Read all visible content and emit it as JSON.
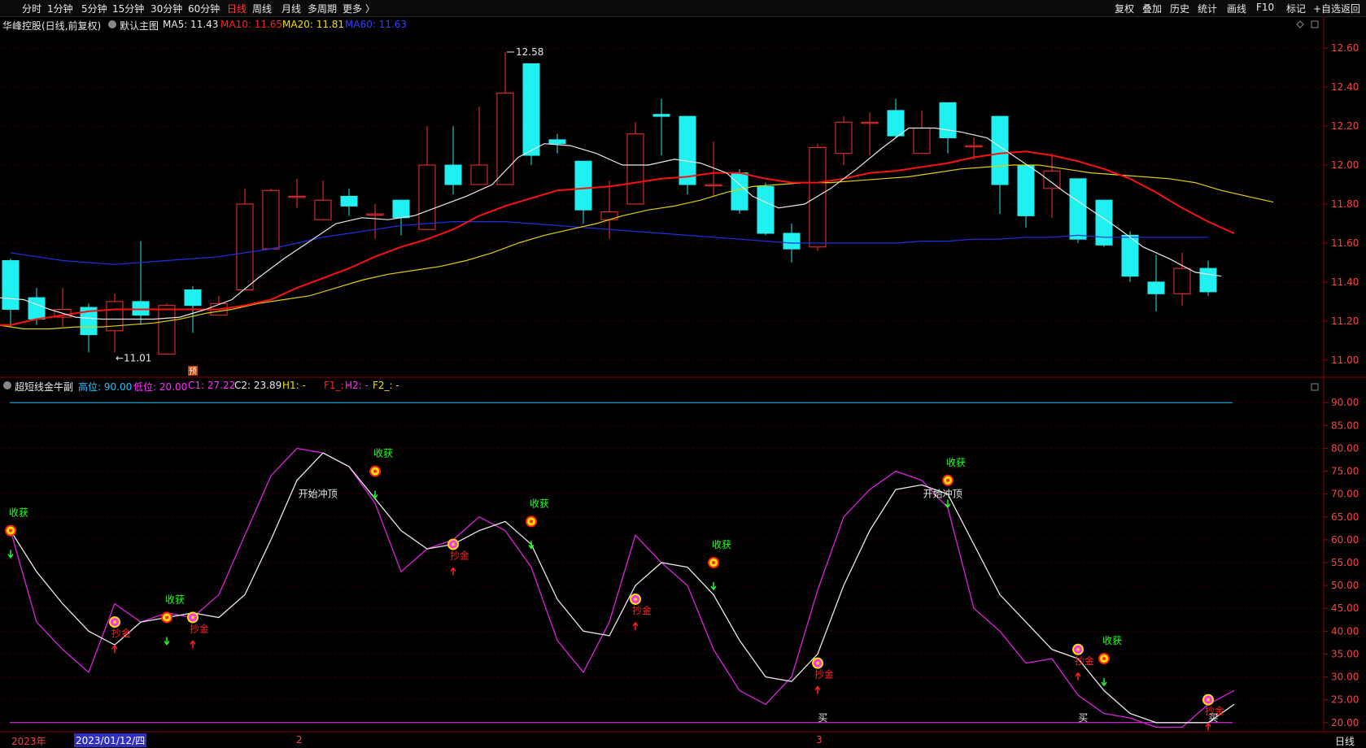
{
  "toolbar": {
    "left_items": [
      "分时",
      "1分钟",
      "5分钟",
      "15分钟",
      "30分钟",
      "60分钟",
      "日线",
      "周线",
      "月线",
      "多周期",
      "更多 〉"
    ],
    "active_item": "日线",
    "right_items": [
      "复权",
      "叠加",
      "历史",
      "统计",
      "画线",
      "F10",
      "标记",
      "+自选",
      "返回"
    ]
  },
  "main_chart": {
    "title": "华峰控股(日线,前复权)",
    "template": "默认主图",
    "ma": [
      {
        "label": "MA5: 11.43",
        "color": "#e8e8e8"
      },
      {
        "label": "MA10: 11.65",
        "color": "#ff2020"
      },
      {
        "label": "MA20: 11.81",
        "color": "#f0e000"
      },
      {
        "label": "MA60: 11.63",
        "color": "#3040ff"
      }
    ],
    "high_label": "12.58",
    "low_label": "←11.01",
    "pre_marker": "预"
  },
  "sub_chart": {
    "title": "超短线金牛副",
    "params": [
      {
        "label": "高位: 90.00",
        "color": "#20c0ff"
      },
      {
        "label": "低位: 20.00",
        "color": "#ff30ff"
      },
      {
        "label": "C1: 27.22",
        "color": "#ff30ff"
      },
      {
        "label": "C2: 23.89",
        "color": "#e8e8e8"
      },
      {
        "label": "H1: -",
        "color": "#f0e000"
      },
      {
        "label": "F1_: -",
        "color": "#ff2020"
      },
      {
        "label": "H2: -",
        "color": "#ff30ff"
      },
      {
        "label": "F2_: -",
        "color": "#f0e000"
      }
    ]
  },
  "axes": {
    "price_ticks": [
      "12.60",
      "12.40",
      "12.20",
      "12.00",
      "11.80",
      "11.60",
      "11.40",
      "11.20",
      "11.00"
    ],
    "osc_ticks": [
      "90.00",
      "85.00",
      "80.00",
      "75.00",
      "70.00",
      "65.00",
      "60.00",
      "55.00",
      "50.00",
      "45.00",
      "40.00",
      "35.00",
      "30.00",
      "25.00",
      "20.00"
    ]
  },
  "bottom_bar": {
    "year_label": "2023年",
    "date_cursor": "2023/01/12/四",
    "month_2": "2",
    "month_3": "3",
    "period": "日线"
  },
  "chart_data": {
    "type": "candlestick",
    "price_range": [
      10.92,
      12.68
    ],
    "candles": [
      [
        11.51,
        11.26,
        11.52,
        11.17
      ],
      [
        11.32,
        11.21,
        11.37,
        11.18
      ],
      [
        11.22,
        11.26,
        11.37,
        11.17
      ],
      [
        11.27,
        11.13,
        11.29,
        11.04
      ],
      [
        11.15,
        11.3,
        11.34,
        11.04
      ],
      [
        11.3,
        11.23,
        11.61,
        11.18
      ],
      [
        11.03,
        11.28,
        11.29,
        11.03
      ],
      [
        11.36,
        11.28,
        11.38,
        11.14
      ],
      [
        11.23,
        11.29,
        11.33,
        11.23
      ],
      [
        11.36,
        11.8,
        11.88,
        11.36
      ],
      [
        11.57,
        11.87,
        11.88,
        11.57
      ],
      [
        11.84,
        11.84,
        11.93,
        11.78
      ],
      [
        11.72,
        11.82,
        11.92,
        11.72
      ],
      [
        11.84,
        11.79,
        11.88,
        11.74
      ],
      [
        11.75,
        11.75,
        11.8,
        11.62
      ],
      [
        11.82,
        11.73,
        11.82,
        11.64
      ],
      [
        11.67,
        12.0,
        12.2,
        11.67
      ],
      [
        12.0,
        11.9,
        12.2,
        11.85
      ],
      [
        11.9,
        12.0,
        12.3,
        11.9
      ],
      [
        11.9,
        12.37,
        12.58,
        11.9
      ],
      [
        12.52,
        12.05,
        12.52,
        12.0
      ],
      [
        12.13,
        12.11,
        12.16,
        12.06
      ],
      [
        12.02,
        11.77,
        12.02,
        11.7
      ],
      [
        11.72,
        11.76,
        11.92,
        11.62
      ],
      [
        11.8,
        12.16,
        12.22,
        11.8
      ],
      [
        12.26,
        12.25,
        12.34,
        12.05
      ],
      [
        12.25,
        11.9,
        12.25,
        11.85
      ],
      [
        11.9,
        11.9,
        12.12,
        11.84
      ],
      [
        11.96,
        11.77,
        11.98,
        11.75
      ],
      [
        11.89,
        11.65,
        11.91,
        11.64
      ],
      [
        11.65,
        11.57,
        11.7,
        11.5
      ],
      [
        11.58,
        12.09,
        12.11,
        11.56
      ],
      [
        12.06,
        12.22,
        12.25,
        12.0
      ],
      [
        12.22,
        12.22,
        12.27,
        12.05
      ],
      [
        12.28,
        12.15,
        12.34,
        12.14
      ],
      [
        12.06,
        12.19,
        12.28,
        12.06
      ],
      [
        12.32,
        12.14,
        12.32,
        12.06
      ],
      [
        12.1,
        12.1,
        12.14,
        12.03
      ],
      [
        12.25,
        11.9,
        12.25,
        11.75
      ],
      [
        12.0,
        11.74,
        12.0,
        11.68
      ],
      [
        11.88,
        11.97,
        12.06,
        11.73
      ],
      [
        11.93,
        11.62,
        11.93,
        11.6
      ],
      [
        11.82,
        11.59,
        11.82,
        11.58
      ],
      [
        11.64,
        11.43,
        11.66,
        11.4
      ],
      [
        11.4,
        11.34,
        11.54,
        11.25
      ],
      [
        11.34,
        11.47,
        11.55,
        11.28
      ],
      [
        11.47,
        11.35,
        11.51,
        11.33
      ]
    ],
    "ma5": [
      11.32,
      11.31,
      11.26,
      11.22,
      11.21,
      11.21,
      11.21,
      11.22,
      11.26,
      11.31,
      11.42,
      11.52,
      11.61,
      11.7,
      11.73,
      11.72,
      11.74,
      11.79,
      11.84,
      11.9,
      12.04,
      12.11,
      12.1,
      12.06,
      12.0,
      12.0,
      12.03,
      12.01,
      11.96,
      11.84,
      11.78,
      11.8,
      11.88,
      11.98,
      12.09,
      12.19,
      12.19,
      12.17,
      12.14,
      12.05,
      11.96,
      11.86,
      11.77,
      11.68,
      11.58,
      11.52,
      11.45,
      11.43
    ],
    "ma10": [
      11.18,
      11.18,
      11.21,
      11.23,
      11.25,
      11.26,
      11.26,
      11.26,
      11.26,
      11.26,
      11.28,
      11.31,
      11.37,
      11.42,
      11.47,
      11.53,
      11.58,
      11.62,
      11.67,
      11.74,
      11.79,
      11.83,
      11.87,
      11.88,
      11.89,
      11.91,
      11.93,
      11.94,
      11.96,
      11.96,
      11.93,
      11.91,
      11.91,
      11.93,
      11.96,
      11.97,
      11.99,
      12.01,
      12.04,
      12.06,
      12.07,
      12.05,
      12.02,
      11.98,
      11.93,
      11.86,
      11.78,
      11.71,
      11.65
    ],
    "ma20": [
      11.2,
      11.18,
      11.16,
      11.16,
      11.17,
      11.17,
      11.18,
      11.19,
      11.21,
      11.24,
      11.26,
      11.29,
      11.31,
      11.33,
      11.37,
      11.41,
      11.44,
      11.46,
      11.48,
      11.51,
      11.55,
      11.6,
      11.64,
      11.67,
      11.7,
      11.74,
      11.77,
      11.79,
      11.82,
      11.86,
      11.89,
      11.9,
      11.91,
      11.91,
      11.92,
      11.93,
      11.94,
      11.96,
      11.98,
      11.99,
      12.0,
      12.0,
      11.98,
      11.96,
      11.95,
      11.94,
      11.93,
      11.91,
      11.87,
      11.84,
      11.81
    ],
    "ma60": [
      11.55,
      11.53,
      11.51,
      11.5,
      11.49,
      11.5,
      11.51,
      11.52,
      11.53,
      11.55,
      11.57,
      11.6,
      11.63,
      11.65,
      11.67,
      11.69,
      11.7,
      11.71,
      11.71,
      11.71,
      11.7,
      11.69,
      11.68,
      11.67,
      11.66,
      11.65,
      11.64,
      11.63,
      11.62,
      11.61,
      11.6,
      11.6,
      11.6,
      11.6,
      11.6,
      11.61,
      11.61,
      11.62,
      11.62,
      11.63,
      11.63,
      11.64,
      11.63,
      11.63,
      11.63,
      11.63,
      11.63
    ],
    "c1": [
      62,
      42,
      36,
      31,
      46,
      42,
      44,
      43,
      48,
      61,
      74,
      80,
      79,
      76,
      68,
      53,
      58,
      60,
      65,
      62,
      54,
      38,
      31,
      42,
      61,
      55,
      50,
      36,
      27,
      24,
      30,
      49,
      65,
      71,
      75,
      73,
      67,
      45,
      40,
      33,
      34,
      26,
      22,
      21,
      19,
      19,
      24,
      27
    ],
    "c2": [
      62,
      53,
      46,
      40,
      37,
      42,
      43,
      44,
      43,
      48,
      60,
      73,
      79,
      76,
      69,
      62,
      58,
      59,
      62,
      64,
      59,
      47,
      40,
      39,
      50,
      55,
      54,
      48,
      38,
      30,
      29,
      35,
      50,
      62,
      71,
      72,
      70,
      59,
      48,
      42,
      36,
      34,
      27,
      22,
      20,
      20,
      20,
      24
    ],
    "osc_range": [
      18,
      92
    ],
    "high_line": 90,
    "low_line": 20,
    "annotations": [
      {
        "i": 0,
        "v": 62,
        "label": "收获",
        "kind": "harvest"
      },
      {
        "i": 4,
        "v": 42,
        "label": "抄金",
        "kind": "gold"
      },
      {
        "i": 6,
        "v": 43,
        "label": "收获",
        "kind": "harvest"
      },
      {
        "i": 7,
        "v": 43,
        "label": "抄金",
        "kind": "gold"
      },
      {
        "i": 14,
        "v": 75,
        "label": "收获",
        "kind": "harvest"
      },
      {
        "i": 17,
        "v": 59,
        "label": "抄金",
        "kind": "gold"
      },
      {
        "i": 20,
        "v": 64,
        "label": "收获",
        "kind": "harvest"
      },
      {
        "i": 24,
        "v": 47,
        "label": "抄金",
        "kind": "gold"
      },
      {
        "i": 27,
        "v": 55,
        "label": "收获",
        "kind": "harvest"
      },
      {
        "i": 31,
        "v": 33,
        "label": "抄金",
        "kind": "gold"
      },
      {
        "i": 36,
        "v": 73,
        "label": "收获",
        "kind": "harvest"
      },
      {
        "i": 41,
        "v": 36,
        "label": "抄金",
        "kind": "gold"
      },
      {
        "i": 42,
        "v": 34,
        "label": "收获",
        "kind": "harvest"
      },
      {
        "i": 46,
        "v": 25,
        "label": "抄金",
        "kind": "gold"
      }
    ],
    "text_marks": [
      {
        "i": 11.8,
        "v": 70,
        "label": "开始冲顶"
      },
      {
        "i": 35.8,
        "v": 70,
        "label": "开始冲顶"
      },
      {
        "i": 31.2,
        "v": 21,
        "label": "买"
      },
      {
        "i": 41.2,
        "v": 21,
        "label": "买"
      },
      {
        "i": 46.2,
        "v": 21,
        "label": "买"
      }
    ]
  }
}
